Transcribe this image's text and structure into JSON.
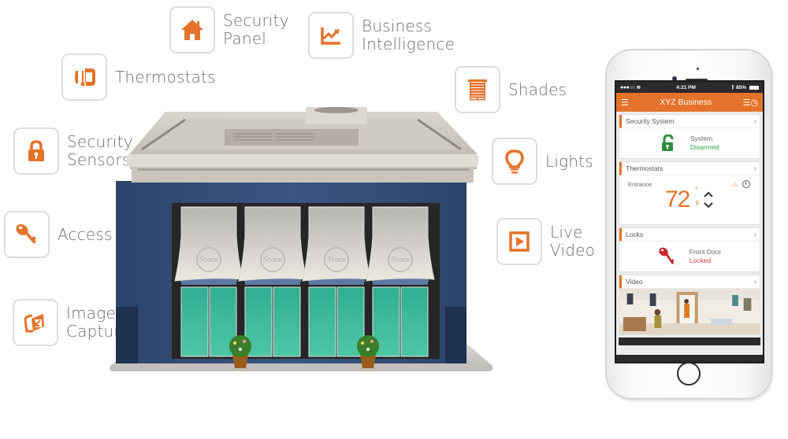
{
  "features": [
    {
      "id": "security-panel",
      "icon": "house-icon",
      "lines": [
        "Security",
        "Panel"
      ]
    },
    {
      "id": "business-intelligence",
      "icon": "trend-chart-icon",
      "lines": [
        "Business",
        "Intelligence"
      ]
    },
    {
      "id": "thermostats",
      "icon": "thermostat-icon",
      "lines": [
        "Thermostats"
      ]
    },
    {
      "id": "shades",
      "icon": "window-shade-icon",
      "lines": [
        "Shades"
      ]
    },
    {
      "id": "security-sensors",
      "icon": "padlock-icon",
      "lines": [
        "Security",
        "Sensors"
      ]
    },
    {
      "id": "lights",
      "icon": "lightbulb-icon",
      "lines": [
        "Lights"
      ]
    },
    {
      "id": "access",
      "icon": "key-icon",
      "lines": [
        "Access"
      ]
    },
    {
      "id": "live-video",
      "icon": "play-icon",
      "lines": [
        "Live",
        "Video"
      ]
    },
    {
      "id": "image-capture",
      "icon": "image-capture-icon",
      "lines": [
        "Image",
        "Capture"
      ]
    }
  ],
  "building": {
    "awning_text": "Store"
  },
  "phone": {
    "status_bar": {
      "signal": "●●●○○",
      "wifi": "wifi-icon",
      "time": "4:21 PM",
      "bluetooth": "bluetooth-icon",
      "battery": "85%"
    },
    "app_bar": {
      "title": "XYZ Business",
      "menu_icon": "hamburger-menu-icon",
      "right_icon": "schedule-icon"
    },
    "cards": {
      "security": {
        "title": "Security System",
        "line1": "System",
        "line2": "Disarmed",
        "icon": "unlocked-padlock-icon"
      },
      "thermostats": {
        "title": "Thermostats",
        "location": "Entrance",
        "temperature": "72",
        "degree": "°",
        "unit": "F",
        "mode_icon": "flame-icon",
        "schedule_icon": "clock-icon"
      },
      "locks": {
        "title": "Locks",
        "line1": "Front Door",
        "line2": "Locked",
        "icon": "key-icon"
      },
      "video": {
        "title": "Video"
      }
    }
  },
  "colors": {
    "accent": "#e5722a",
    "green": "#3aa150",
    "red": "#d73636",
    "label": "#6d6d6d",
    "building_blue": "#2f4a72",
    "glass": "#3bbf9e"
  }
}
